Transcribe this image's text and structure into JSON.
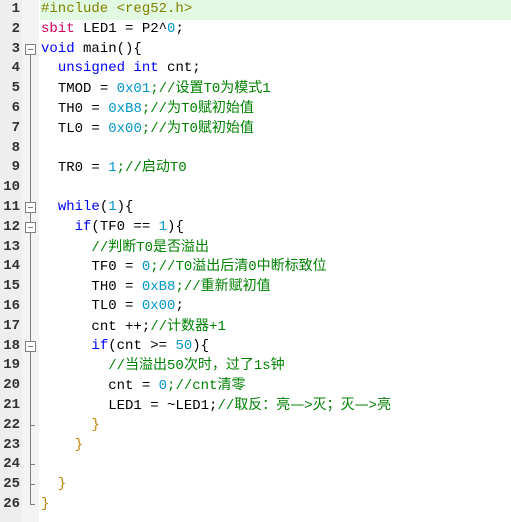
{
  "editor": {
    "current_line": 1,
    "lines": [
      {
        "n": "1",
        "fold": "none",
        "indent": "",
        "tokens": [
          [
            "pre",
            "#include <reg52.h>"
          ]
        ]
      },
      {
        "n": "2",
        "fold": "none",
        "indent": "",
        "tokens": [
          [
            "sbit",
            "sbit"
          ],
          [
            "id",
            " LED1 = P2^"
          ],
          [
            "num",
            "0"
          ],
          [
            "id",
            ";"
          ]
        ]
      },
      {
        "n": "3",
        "fold": "open",
        "indent": "",
        "tokens": [
          [
            "kw",
            "void"
          ],
          [
            "id",
            " main(){"
          ]
        ]
      },
      {
        "n": "4",
        "fold": "line",
        "indent": "  ",
        "tokens": [
          [
            "kw",
            "unsigned int"
          ],
          [
            "id",
            " cnt;"
          ]
        ]
      },
      {
        "n": "5",
        "fold": "line",
        "indent": "  ",
        "tokens": [
          [
            "id",
            "TMOD = "
          ],
          [
            "num",
            "0x01"
          ],
          [
            "cmt",
            ";//设置T0为模式1"
          ]
        ]
      },
      {
        "n": "6",
        "fold": "line",
        "indent": "  ",
        "tokens": [
          [
            "id",
            "TH0 = "
          ],
          [
            "num",
            "0xB8"
          ],
          [
            "cmt",
            ";//为T0赋初始值"
          ]
        ]
      },
      {
        "n": "7",
        "fold": "line",
        "indent": "  ",
        "tokens": [
          [
            "id",
            "TL0 = "
          ],
          [
            "num",
            "0x00"
          ],
          [
            "cmt",
            ";//为T0赋初始值"
          ]
        ]
      },
      {
        "n": "8",
        "fold": "line",
        "indent": "",
        "tokens": []
      },
      {
        "n": "9",
        "fold": "line",
        "indent": "  ",
        "tokens": [
          [
            "id",
            "TR0 = "
          ],
          [
            "num",
            "1"
          ],
          [
            "cmt",
            ";//启动T0"
          ]
        ]
      },
      {
        "n": "10",
        "fold": "line",
        "indent": "",
        "tokens": []
      },
      {
        "n": "11",
        "fold": "open",
        "indent": "  ",
        "tokens": [
          [
            "kw",
            "while"
          ],
          [
            "id",
            "("
          ],
          [
            "num",
            "1"
          ],
          [
            "id",
            "){"
          ]
        ]
      },
      {
        "n": "12",
        "fold": "open",
        "indent": "    ",
        "tokens": [
          [
            "kw",
            "if"
          ],
          [
            "id",
            "(TF0 == "
          ],
          [
            "num",
            "1"
          ],
          [
            "id",
            "){"
          ]
        ]
      },
      {
        "n": "13",
        "fold": "line",
        "indent": "      ",
        "tokens": [
          [
            "cmt",
            "//判断T0是否溢出"
          ]
        ]
      },
      {
        "n": "14",
        "fold": "line",
        "indent": "      ",
        "tokens": [
          [
            "id",
            "TF0 = "
          ],
          [
            "num",
            "0"
          ],
          [
            "cmt",
            ";//T0溢出后清0中断标致位"
          ]
        ]
      },
      {
        "n": "15",
        "fold": "line",
        "indent": "      ",
        "tokens": [
          [
            "id",
            "TH0 = "
          ],
          [
            "num",
            "0xB8"
          ],
          [
            "cmt",
            ";//重新赋初值"
          ]
        ]
      },
      {
        "n": "16",
        "fold": "line",
        "indent": "      ",
        "tokens": [
          [
            "id",
            "TL0 = "
          ],
          [
            "num",
            "0x00"
          ],
          [
            "id",
            ";"
          ]
        ]
      },
      {
        "n": "17",
        "fold": "line",
        "indent": "      ",
        "tokens": [
          [
            "id",
            "cnt ++;"
          ],
          [
            "cmt",
            "//计数器+1"
          ]
        ]
      },
      {
        "n": "18",
        "fold": "open",
        "indent": "      ",
        "tokens": [
          [
            "kw",
            "if"
          ],
          [
            "id",
            "(cnt >= "
          ],
          [
            "num",
            "50"
          ],
          [
            "id",
            "){"
          ]
        ]
      },
      {
        "n": "19",
        "fold": "line",
        "indent": "        ",
        "tokens": [
          [
            "cmt",
            "//当溢出50次时，过了1s钟"
          ]
        ]
      },
      {
        "n": "20",
        "fold": "line",
        "indent": "        ",
        "tokens": [
          [
            "id",
            "cnt = "
          ],
          [
            "num",
            "0"
          ],
          [
            "cmt",
            ";//cnt清零"
          ]
        ]
      },
      {
        "n": "21",
        "fold": "line",
        "indent": "        ",
        "tokens": [
          [
            "id",
            "LED1 = ~LED1;"
          ],
          [
            "cmt",
            "//取反：亮—>灭；灭—>亮"
          ]
        ]
      },
      {
        "n": "22",
        "fold": "end",
        "indent": "      ",
        "tokens": [
          [
            "brace",
            "}"
          ]
        ]
      },
      {
        "n": "23",
        "fold": "line",
        "indent": "    ",
        "tokens": [
          [
            "brace",
            "}"
          ]
        ]
      },
      {
        "n": "24",
        "fold": "end",
        "indent": "",
        "tokens": []
      },
      {
        "n": "25",
        "fold": "end",
        "indent": "  ",
        "tokens": [
          [
            "brace",
            "}"
          ]
        ]
      },
      {
        "n": "26",
        "fold": "close",
        "indent": "",
        "tokens": [
          [
            "brace",
            "}"
          ]
        ]
      }
    ]
  }
}
